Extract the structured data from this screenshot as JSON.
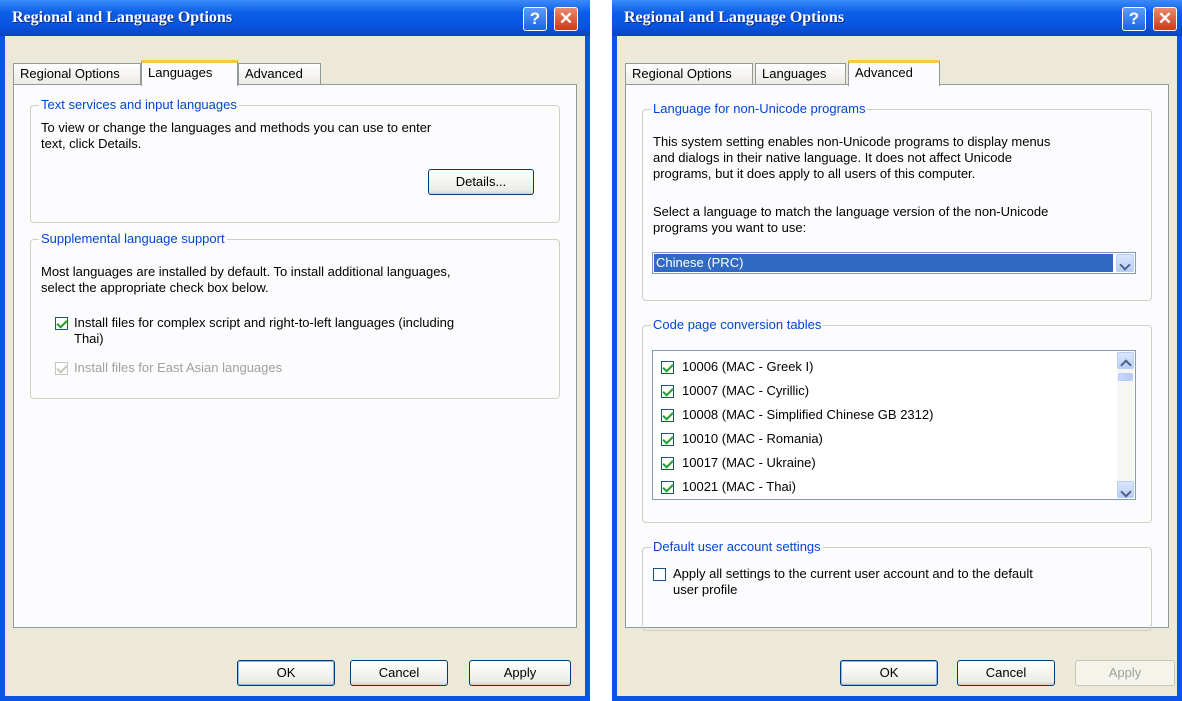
{
  "window_left": {
    "title": "Regional and Language Options",
    "help_btn": "?",
    "close_btn": "✕",
    "tabs": [
      {
        "label": "Regional Options"
      },
      {
        "label": "Languages"
      },
      {
        "label": "Advanced"
      }
    ],
    "active_tab": "Languages",
    "text_services": {
      "legend": "Text services and input languages",
      "description_line1": "To view or change the languages and methods you can use to enter",
      "description_line2": "text, click Details.",
      "details_button": "Details..."
    },
    "supplemental": {
      "legend": "Supplemental language support",
      "description_line1": "Most languages are installed by default. To install additional languages,",
      "description_line2": "select the appropriate check box below.",
      "complex_script_line1": "Install files for complex script and right-to-left languages (including",
      "complex_script_line2": "Thai)",
      "complex_script_checked": true,
      "east_asian": "Install files for East Asian languages",
      "east_asian_checked": true,
      "east_asian_enabled": false
    },
    "buttons": {
      "ok": "OK",
      "cancel": "Cancel",
      "apply": "Apply"
    }
  },
  "window_right": {
    "title": "Regional and Language Options",
    "help_btn": "?",
    "close_btn": "✕",
    "tabs": [
      {
        "label": "Regional Options"
      },
      {
        "label": "Languages"
      },
      {
        "label": "Advanced"
      }
    ],
    "active_tab": "Advanced",
    "non_unicode": {
      "legend": "Language for non-Unicode programs",
      "description_line1": "This system setting enables non-Unicode programs to display menus",
      "description_line2": "and dialogs in their native language. It does not affect Unicode",
      "description_line3": "programs, but it does apply to all users of this computer.",
      "select_prompt_line1": "Select a language to match the language version of the non-Unicode",
      "select_prompt_line2": "programs you want to use:",
      "selected_language": "Chinese (PRC)"
    },
    "code_page": {
      "legend": "Code page conversion tables",
      "items": [
        {
          "label": "10006 (MAC - Greek I)",
          "checked": true
        },
        {
          "label": "10007 (MAC - Cyrillic)",
          "checked": true
        },
        {
          "label": "10008 (MAC - Simplified Chinese GB 2312)",
          "checked": true
        },
        {
          "label": "10010 (MAC - Romania)",
          "checked": true
        },
        {
          "label": "10017 (MAC - Ukraine)",
          "checked": true
        },
        {
          "label": "10021 (MAC - Thai)",
          "checked": true
        }
      ]
    },
    "default_user": {
      "legend": "Default user account settings",
      "apply_all_line1": "Apply all settings to the current user account and to the default",
      "apply_all_line2": "user profile",
      "apply_all_checked": false
    },
    "buttons": {
      "ok": "OK",
      "cancel": "Cancel",
      "apply": "Apply",
      "apply_enabled": false
    }
  },
  "colors": {
    "titlebar": "#0a55e3",
    "dialog_face": "#ece9d8",
    "group_legend": "#0046d5",
    "selection": "#316ac5",
    "active_tab_accent": "#ffc83c"
  }
}
